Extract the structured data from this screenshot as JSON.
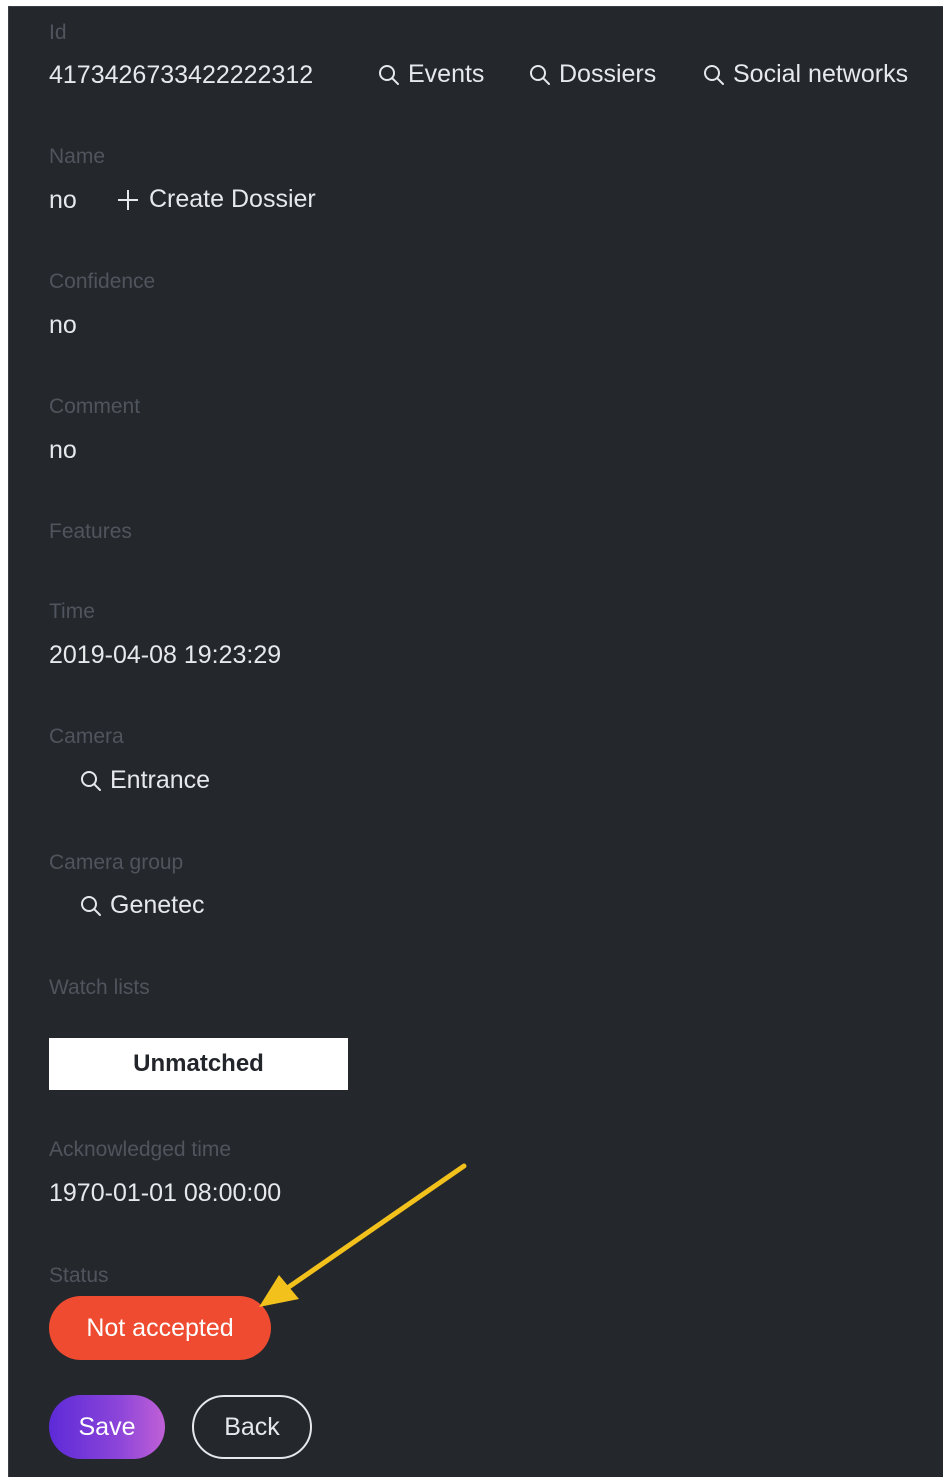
{
  "fields": {
    "id": {
      "label": "Id",
      "value": "4173426733422222312"
    },
    "name": {
      "label": "Name",
      "value": "no"
    },
    "confidence": {
      "label": "Confidence",
      "value": "no"
    },
    "comment": {
      "label": "Comment",
      "value": "no"
    },
    "features": {
      "label": "Features"
    },
    "time": {
      "label": "Time",
      "value": "2019-04-08 19:23:29"
    },
    "camera": {
      "label": "Camera",
      "value": "Entrance"
    },
    "camera_group": {
      "label": "Camera group",
      "value": "Genetec"
    },
    "watch_lists": {
      "label": "Watch lists",
      "value": "Unmatched"
    },
    "acknowledged_time": {
      "label": "Acknowledged time",
      "value": "1970-01-01 08:00:00"
    },
    "status": {
      "label": "Status",
      "value": "Not accepted"
    }
  },
  "links": {
    "events": "Events",
    "dossiers": "Dossiers",
    "social_networks": "Social networks",
    "create_dossier": "Create Dossier"
  },
  "buttons": {
    "save": "Save",
    "back": "Back"
  },
  "icons": {
    "search": "search-icon",
    "plus": "plus-icon",
    "annotation": "arrow-annotation"
  },
  "colors": {
    "background": "#24272c",
    "label": "#50555d",
    "text": "#e6e8eb",
    "status_not_accepted": "#ee4b30",
    "save_gradient_start": "#5d2ad8",
    "save_gradient_end": "#c060d6",
    "annotation_arrow": "#f2c11b"
  }
}
